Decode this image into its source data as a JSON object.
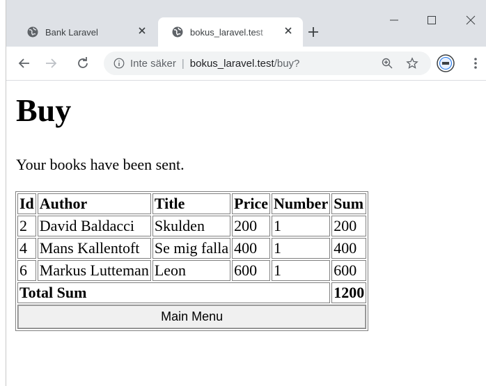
{
  "browser": {
    "tabs": [
      {
        "title": "Bank Laravel",
        "active": false
      },
      {
        "title": "bokus_laravel.test",
        "active": true
      }
    ],
    "address": {
      "security_label": "Inte säker",
      "host": "bokus_laravel.test",
      "path": "/buy?"
    }
  },
  "page": {
    "heading": "Buy",
    "message": "Your books have been sent.",
    "table": {
      "headers": [
        "Id",
        "Author",
        "Title",
        "Price",
        "Number",
        "Sum"
      ],
      "rows": [
        [
          "2",
          "David Baldacci",
          "Skulden",
          "200",
          "1",
          "200"
        ],
        [
          "4",
          "Mans Kallentoft",
          "Se mig falla",
          "400",
          "1",
          "400"
        ],
        [
          "6",
          "Markus Lutteman",
          "Leon",
          "600",
          "1",
          "600"
        ]
      ],
      "total_label": "Total Sum",
      "total_value": "1200",
      "main_menu_label": "Main Menu"
    }
  }
}
